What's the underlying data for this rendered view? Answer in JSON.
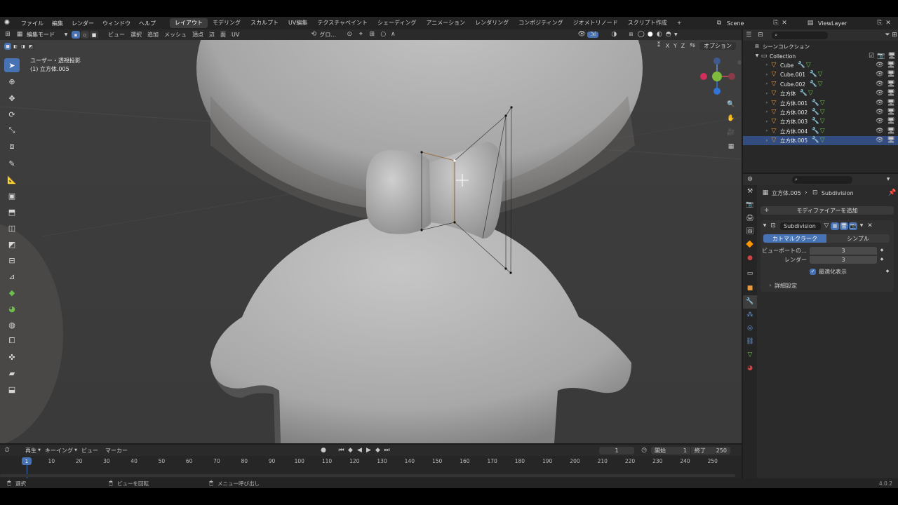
{
  "topbar": {
    "menus": [
      "ファイル",
      "編集",
      "レンダー",
      "ウィンドウ",
      "ヘルプ"
    ],
    "workspaces": [
      "レイアウト",
      "モデリング",
      "スカルプト",
      "UV編集",
      "テクスチャペイント",
      "シェーディング",
      "アニメーション",
      "レンダリング",
      "コンポジティング",
      "ジオメトリノード",
      "スクリプト作成"
    ],
    "active_workspace": "レイアウト",
    "add_tab": "+",
    "scene": "Scene",
    "view_layer": "ViewLayer"
  },
  "viewport_header": {
    "mode": "編集モード",
    "menus": [
      "ビュー",
      "選択",
      "追加",
      "メッシュ",
      "頂点",
      "辺",
      "面",
      "UV"
    ],
    "transform_orientation": "グロ…",
    "options": "オプション",
    "axes": [
      "X",
      "Y",
      "Z"
    ]
  },
  "viewport": {
    "view_label": "ユーザー・透視投影",
    "object_label": "(1) 立方体.005"
  },
  "outliner": {
    "search_placeholder": "",
    "scene_collection": "シーンコレクション",
    "collection": "Collection",
    "items": [
      {
        "name": "Cube",
        "selected": false
      },
      {
        "name": "Cube.001",
        "selected": false
      },
      {
        "name": "Cube.002",
        "selected": false
      },
      {
        "name": "立方体",
        "selected": false
      },
      {
        "name": "立方体.001",
        "selected": false
      },
      {
        "name": "立方体.002",
        "selected": false
      },
      {
        "name": "立方体.003",
        "selected": false
      },
      {
        "name": "立方体.004",
        "selected": false
      },
      {
        "name": "立方体.005",
        "selected": true
      }
    ]
  },
  "properties": {
    "breadcrumb_object": "立方体.005",
    "breadcrumb_modifier": "Subdivision",
    "add_modifier": "モディファイアーを追加",
    "modifier_name": "Subdivision",
    "tab_catmull": "カトマルクラーク",
    "tab_simple": "シンプル",
    "viewport_label": "ビューポートの…",
    "viewport_value": "3",
    "render_label": "レンダー",
    "render_value": "3",
    "optimal_display": "最適化表示",
    "advanced": "詳細設定"
  },
  "timeline": {
    "menus": [
      "再生",
      "キーイング",
      "ビュー",
      "マーカー"
    ],
    "current_frame": "1",
    "start_label": "開始",
    "start_value": "1",
    "end_label": "終了",
    "end_value": "250",
    "ticks": [
      "10",
      "20",
      "30",
      "40",
      "50",
      "60",
      "70",
      "80",
      "90",
      "100",
      "110",
      "120",
      "130",
      "140",
      "150",
      "160",
      "170",
      "180",
      "190",
      "200",
      "210",
      "220",
      "230",
      "240",
      "250"
    ],
    "playhead": "1"
  },
  "statusbar": {
    "select": "選択",
    "rotate_view": "ビューを回転",
    "call_menu": "メニュー呼び出し",
    "version": "4.0.2"
  },
  "colors": {
    "accent": "#4772b3",
    "selected_row": "#334d80",
    "viewport_bg": "#3d3d3d",
    "mesh": "#a9a9a9"
  }
}
